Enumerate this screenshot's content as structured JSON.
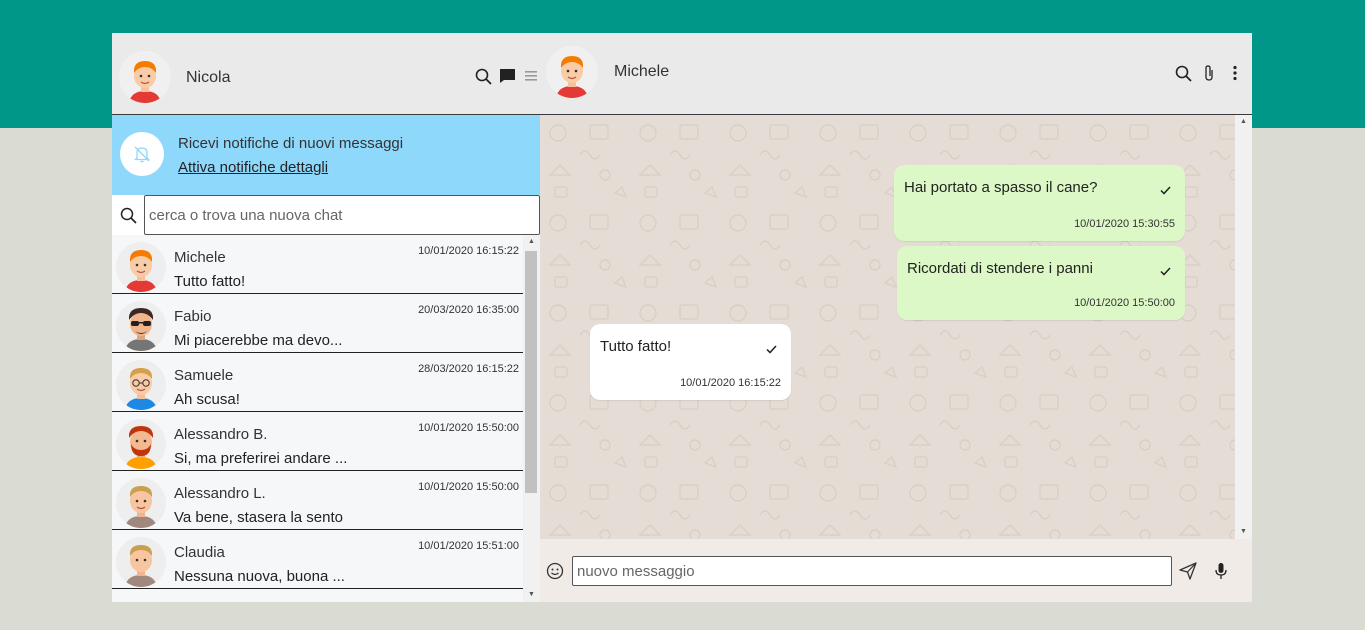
{
  "theme": {
    "band": "#009688",
    "background": "#dadbd3",
    "notification": "#8ed8fc",
    "sent_bubble": "#dcf8c6",
    "received_bubble": "#ffffff"
  },
  "sidebar": {
    "user_name": "Nicola",
    "icons": [
      "search-icon",
      "chat-icon",
      "menu-icon"
    ],
    "notification": {
      "icon": "bell-off-icon",
      "title": "Ricevi notifiche di nuovi messaggi",
      "link": "Attiva notifiche dettagli"
    },
    "search": {
      "placeholder": "cerca o trova una nuova chat",
      "value": ""
    },
    "chats": [
      {
        "name": "Michele",
        "last_message": "Tutto fatto!",
        "date": "10/01/2020 16:15:22"
      },
      {
        "name": "Fabio",
        "last_message": "Mi piacerebbe ma devo...",
        "date": "20/03/2020 16:35:00"
      },
      {
        "name": "Samuele",
        "last_message": "Ah scusa!",
        "date": "28/03/2020 16:15:22"
      },
      {
        "name": "Alessandro B.",
        "last_message": "Si, ma preferirei andare ...",
        "date": "10/01/2020 15:50:00"
      },
      {
        "name": "Alessandro L.",
        "last_message": "Va bene, stasera la sento",
        "date": "10/01/2020 15:50:00"
      },
      {
        "name": "Claudia",
        "last_message": "Nessuna nuova, buona ...",
        "date": "10/01/2020 15:51:00"
      }
    ]
  },
  "conversation": {
    "contact_name": "Michele",
    "icons": [
      "search-icon",
      "paperclip-icon",
      "more-vertical-icon"
    ],
    "messages": [
      {
        "direction": "sent",
        "text": "Hai portato a spasso il cane?",
        "time": "10/01/2020 15:30:55",
        "status": "check-icon"
      },
      {
        "direction": "sent",
        "text": "Ricordati di stendere i panni",
        "time": "10/01/2020 15:50:00",
        "status": "check-icon"
      },
      {
        "direction": "received",
        "text": "Tutto fatto!",
        "time": "10/01/2020 16:15:22",
        "status": "check-icon"
      }
    ],
    "composer": {
      "placeholder": "nuovo messaggio",
      "value": "",
      "icons": [
        "emoji-icon",
        "send-icon",
        "mic-icon"
      ]
    }
  }
}
